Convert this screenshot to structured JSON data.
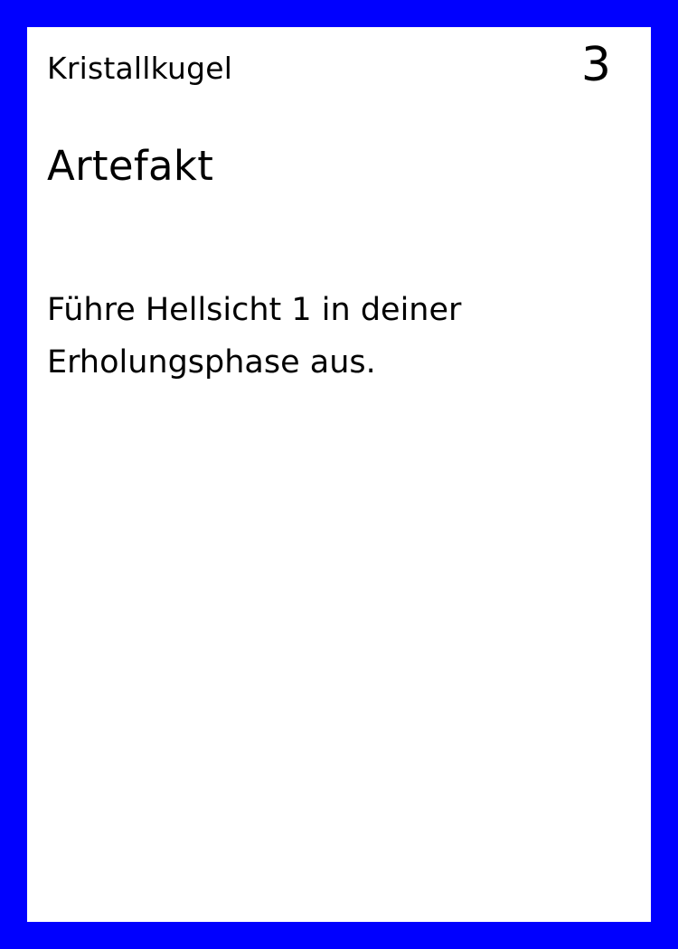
{
  "card": {
    "name": "Kristallkugel",
    "cost": "3",
    "type": "Artefakt",
    "text": "Führe Hellsicht 1 in deiner Erholungsphase aus.",
    "colors": {
      "border": "#0000ff",
      "face": "#ffffff",
      "text": "#000000"
    }
  }
}
